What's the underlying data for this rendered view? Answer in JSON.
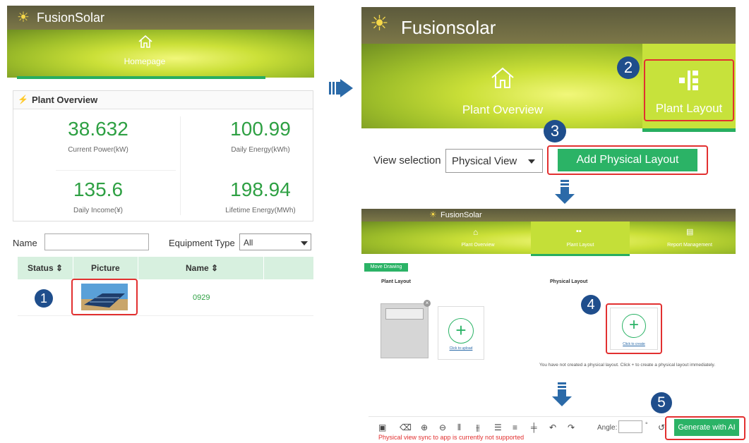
{
  "left": {
    "logo": "FusionSolar",
    "nav_home": "Homepage",
    "overview_title": "Plant Overview",
    "stats": [
      {
        "value": "38.632",
        "label": "Current Power(kW)"
      },
      {
        "value": "100.99",
        "label": "Daily Energy(kWh)"
      },
      {
        "value": "135.6",
        "label": "Daily Income(¥)"
      },
      {
        "value": "198.94",
        "label": "Lifetime Energy(MWh)"
      }
    ],
    "filter_name_label": "Name",
    "filter_equip_label": "Equipment Type",
    "filter_equip_value": "All",
    "table_headers": [
      "Status",
      "Picture",
      "Name"
    ],
    "row_name": "0929",
    "badge": "1"
  },
  "right_top": {
    "logo": "Fusionsolar",
    "nav_overview": "Plant Overview",
    "nav_layout": "Plant Layout",
    "badge2": "2",
    "badge3": "3",
    "view_label": "View selection",
    "view_value": "Physical View",
    "add_button": "Add Physical Layout"
  },
  "right_mid": {
    "logo": "FusionSolar",
    "nav": [
      "Plant Overview",
      "Plant Layout",
      "Report Management"
    ],
    "move_button": "Move Drawing",
    "plant_layout_label": "Plant Layout",
    "physical_layout_label": "Physical Layout",
    "upload_link": "Click to upload",
    "create_link": "Click to create",
    "hint": "You have not created a physical layout. Click + to create a physical layout immediately.",
    "badge4": "4"
  },
  "right_bottom": {
    "angle_label": "Angle:",
    "angle_unit": "°",
    "generate_button": "Generate with AI",
    "warning": "Physical view sync to app is currently not supported",
    "badge5": "5"
  },
  "colors": {
    "accent_green": "#2bb366",
    "value_green": "#2ea043",
    "highlight_red": "#e23030",
    "badge_blue": "#1f4e8c"
  }
}
